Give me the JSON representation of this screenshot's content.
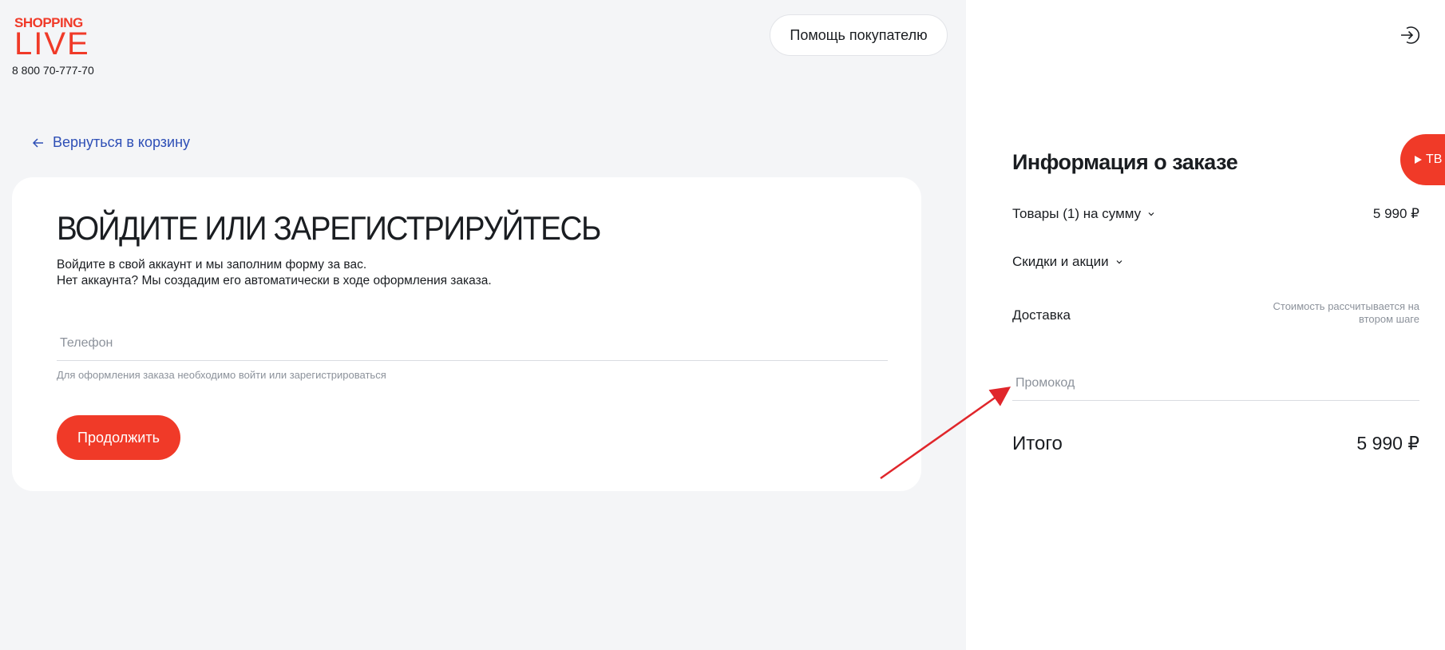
{
  "brand": {
    "logo_top": "SHOPPING",
    "logo_bottom": "LIVE",
    "phone": "8 800 70-777-70",
    "accent_color": "#f03a28"
  },
  "header": {
    "help_label": "Помощь покупателю"
  },
  "nav": {
    "back_label": "Вернуться в корзину"
  },
  "login_card": {
    "title": "ВОЙДИТЕ ИЛИ ЗАРЕГИСТРИРУЙТЕСЬ",
    "subtitle_line1": "Войдите в свой аккаунт и мы заполним форму за вас.",
    "subtitle_line2": "Нет аккаунта? Мы создадим его автоматически в ходе оформления заказа.",
    "phone_placeholder": "Телефон",
    "phone_value": "",
    "hint": "Для оформления заказа необходимо войти или зарегистрироваться",
    "continue_label": "Продолжить"
  },
  "order": {
    "title": "Информация о заказе",
    "goods_label": "Товары (1) на сумму",
    "goods_value": "5 990 ₽",
    "discounts_label": "Скидки и акции",
    "delivery_label": "Доставка",
    "delivery_note": "Стоимость рассчитывается на втором шаге",
    "promo_placeholder": "Промокод",
    "promo_value": "",
    "total_label": "Итого",
    "total_value": "5 990 ₽"
  },
  "tv_button": {
    "label": "ТВ"
  },
  "icons": {
    "back": "arrow-left-icon",
    "logout": "logout-icon",
    "chevron": "chevron-down-icon",
    "play": "play-icon"
  },
  "annotation": {
    "arrow_color": "#e0262b"
  }
}
